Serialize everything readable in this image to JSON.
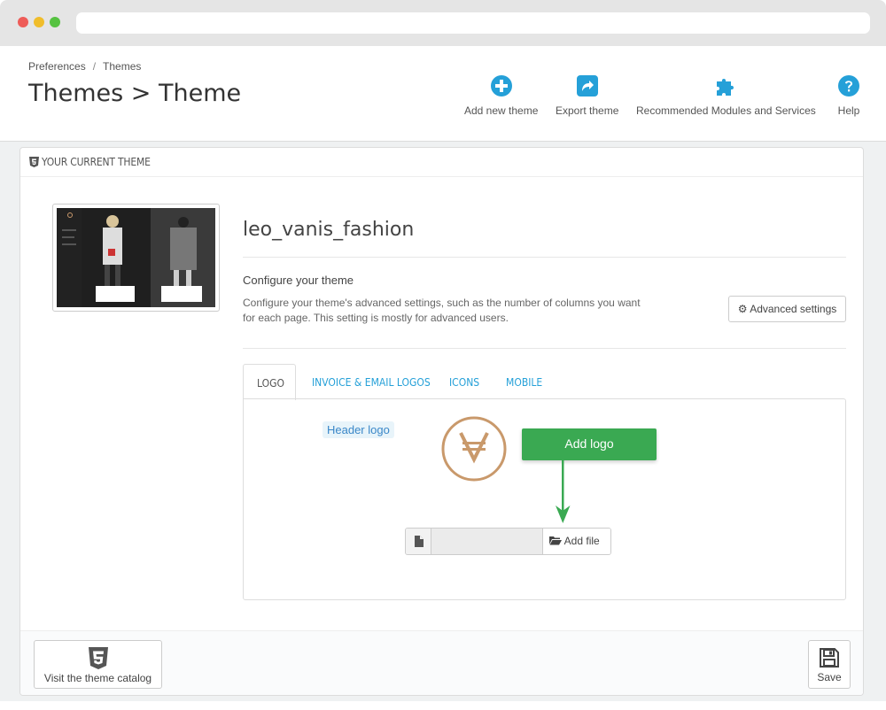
{
  "header": {
    "breadcrumb": [
      "Preferences",
      "Themes"
    ],
    "breadcrumb_sep": "/",
    "title": "Themes > Theme",
    "toolbar": [
      {
        "label": "Add new theme",
        "icon": "plus-circle-icon"
      },
      {
        "label": "Export theme",
        "icon": "share-icon"
      },
      {
        "label": "Recommended Modules and Services",
        "icon": "puzzle-icon"
      },
      {
        "label": "Help",
        "icon": "question-circle-icon"
      }
    ]
  },
  "panel": {
    "heading": "YOUR CURRENT THEME",
    "theme_name": "leo_vanis_fashion",
    "config_title": "Configure your theme",
    "config_desc": "Configure your theme's advanced settings, such as the number of columns you want for each page. This setting is mostly for advanced users.",
    "advanced_settings_label": "Advanced settings",
    "tabs": [
      "LOGO",
      "INVOICE & EMAIL LOGOS",
      "ICONS",
      "MOBILE"
    ],
    "active_tab": "LOGO",
    "header_logo_label": "Header logo",
    "add_logo_label": "Add logo",
    "add_file_label": "Add file",
    "catalog_label": "Visit the theme catalog",
    "save_label": "Save"
  },
  "colors": {
    "accent_blue": "#25a0d8",
    "green": "#3aa952",
    "logo_tan": "#c9996b"
  }
}
